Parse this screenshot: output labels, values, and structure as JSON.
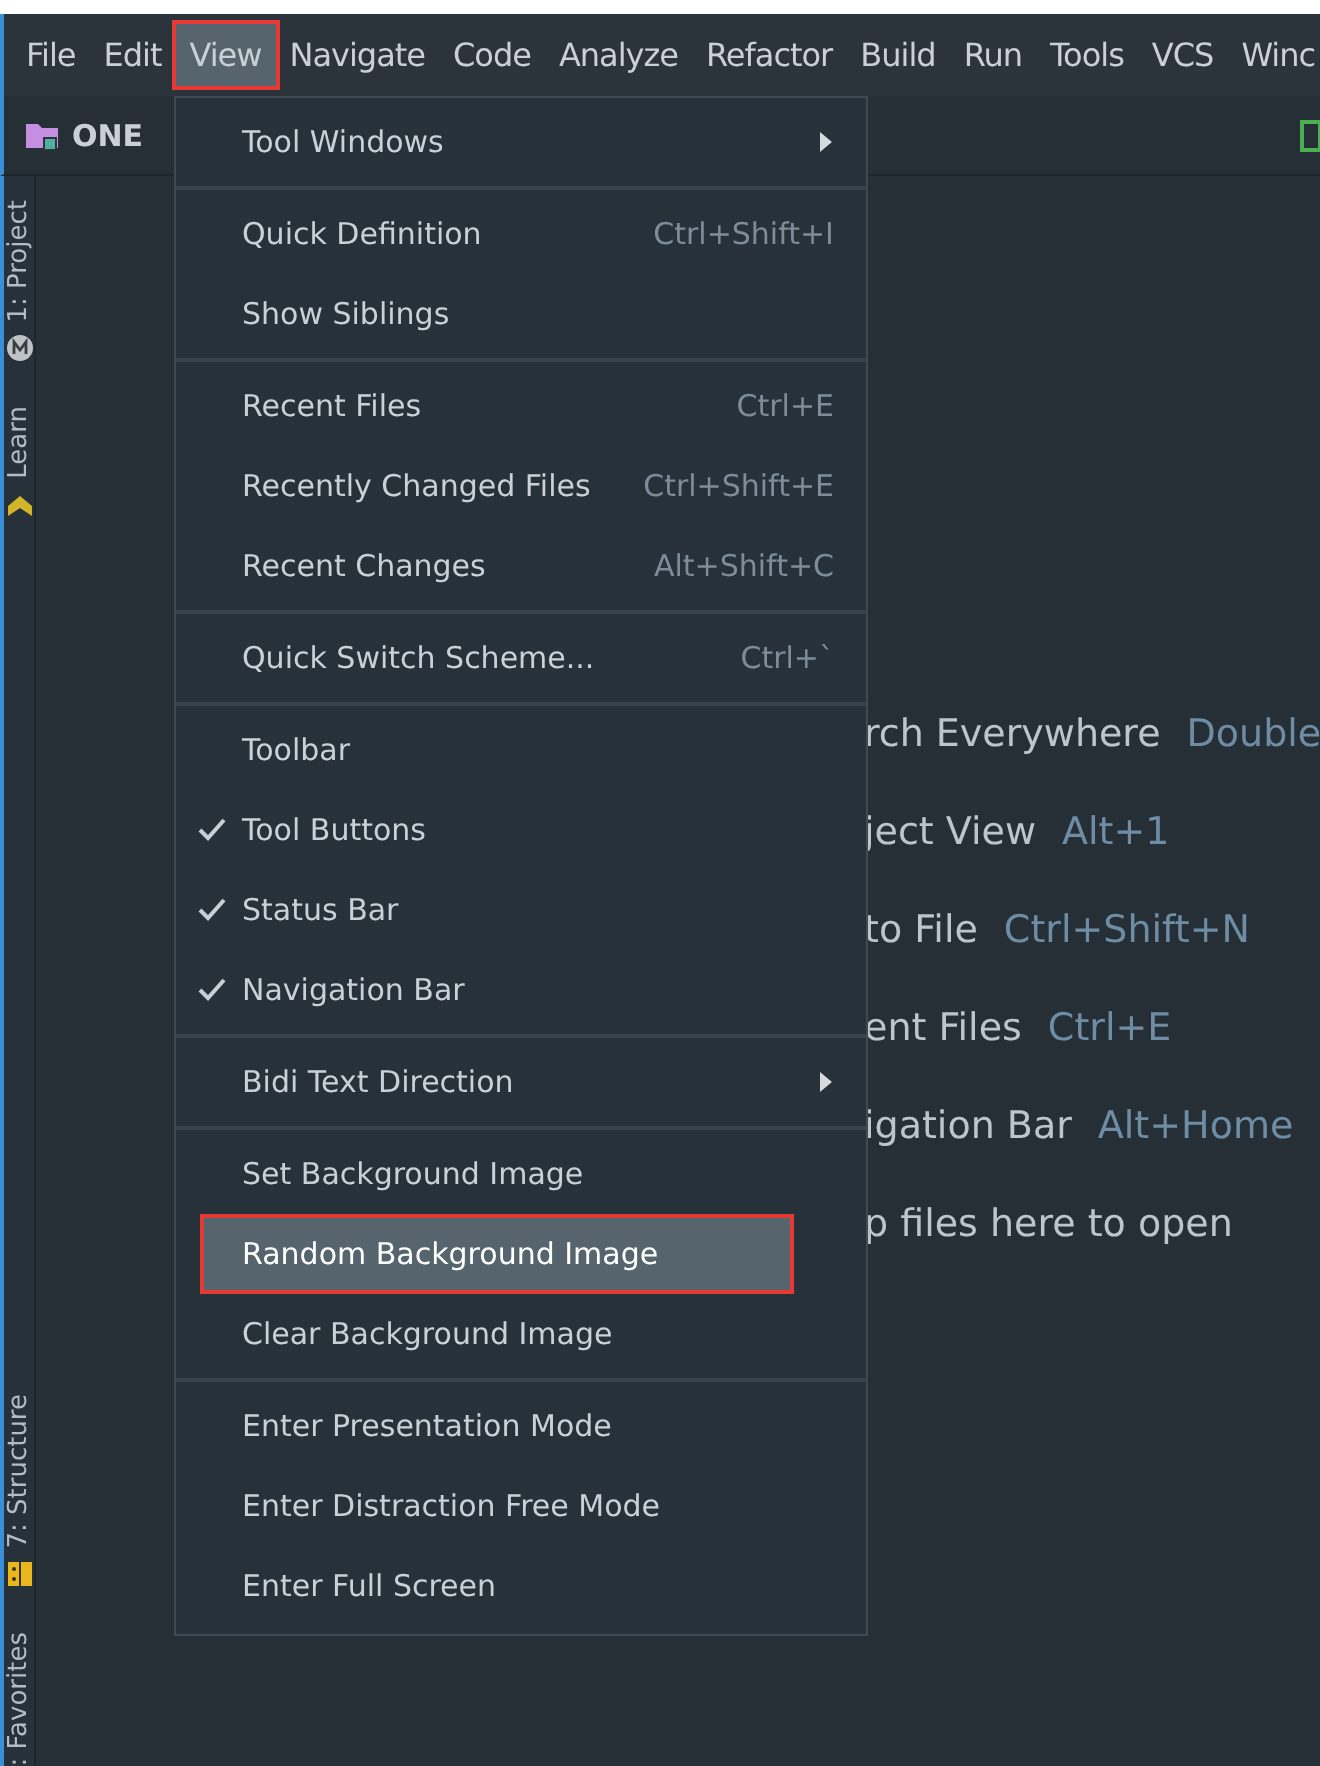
{
  "menu_bar": [
    {
      "label": "File",
      "selected": false,
      "marked": false
    },
    {
      "label": "Edit",
      "selected": false,
      "marked": false
    },
    {
      "label": "View",
      "selected": true,
      "marked": true
    },
    {
      "label": "Navigate",
      "selected": false,
      "marked": false
    },
    {
      "label": "Code",
      "selected": false,
      "marked": false
    },
    {
      "label": "Analyze",
      "selected": false,
      "marked": false
    },
    {
      "label": "Refactor",
      "selected": false,
      "marked": false
    },
    {
      "label": "Build",
      "selected": false,
      "marked": false
    },
    {
      "label": "Run",
      "selected": false,
      "marked": false
    },
    {
      "label": "Tools",
      "selected": false,
      "marked": false
    },
    {
      "label": "VCS",
      "selected": false,
      "marked": false
    },
    {
      "label": "Winc",
      "selected": false,
      "marked": false
    }
  ],
  "navigation_bar": {
    "project": "ONE"
  },
  "side_tabs_top": [
    {
      "label": "1: Project"
    },
    {
      "label": "Learn"
    }
  ],
  "side_tabs_bottom": [
    {
      "label": "7: Structure"
    },
    {
      "label": ": Favorites"
    }
  ],
  "hints": [
    {
      "action": "rch Everywhere",
      "shortcut": "Double"
    },
    {
      "action": "ject View",
      "shortcut": "Alt+1"
    },
    {
      "action": "to File",
      "shortcut": "Ctrl+Shift+N"
    },
    {
      "action": "ent Files",
      "shortcut": "Ctrl+E"
    },
    {
      "action": "igation Bar",
      "shortcut": "Alt+Home"
    },
    {
      "action": "p files here to open"
    }
  ],
  "view_menu": [
    [
      {
        "label": "Tool Windows",
        "submenu": true,
        "checked": false,
        "selected": false,
        "marked": false
      }
    ],
    [
      {
        "label": "Quick Definition",
        "shortcut": "Ctrl+Shift+I",
        "checked": false,
        "selected": false,
        "marked": false
      },
      {
        "label": "Show Siblings",
        "checked": false,
        "selected": false,
        "marked": false
      }
    ],
    [
      {
        "label": "Recent Files",
        "shortcut": "Ctrl+E",
        "checked": false,
        "selected": false,
        "marked": false
      },
      {
        "label": "Recently Changed Files",
        "shortcut": "Ctrl+Shift+E",
        "checked": false,
        "selected": false,
        "marked": false
      },
      {
        "label": "Recent Changes",
        "shortcut": "Alt+Shift+C",
        "checked": false,
        "selected": false,
        "marked": false
      }
    ],
    [
      {
        "label": "Quick Switch Scheme...",
        "shortcut": "Ctrl+`",
        "checked": false,
        "selected": false,
        "marked": false
      }
    ],
    [
      {
        "label": "Toolbar",
        "checked": false,
        "selected": false,
        "marked": false
      },
      {
        "label": "Tool Buttons",
        "checked": true,
        "selected": false,
        "marked": false
      },
      {
        "label": "Status Bar",
        "checked": true,
        "selected": false,
        "marked": false
      },
      {
        "label": "Navigation Bar",
        "checked": true,
        "selected": false,
        "marked": false
      }
    ],
    [
      {
        "label": "Bidi Text Direction",
        "submenu": true,
        "checked": false,
        "selected": false,
        "marked": false
      }
    ],
    [
      {
        "label": "Set Background Image",
        "checked": false,
        "selected": false,
        "marked": false
      },
      {
        "label": "Random Background Image",
        "checked": false,
        "selected": true,
        "marked": true
      },
      {
        "label": "Clear Background Image",
        "checked": false,
        "selected": false,
        "marked": false
      }
    ],
    [
      {
        "label": "Enter Presentation Mode",
        "checked": false,
        "selected": false,
        "marked": false
      },
      {
        "label": "Enter Distraction Free Mode",
        "checked": false,
        "selected": false,
        "marked": false
      },
      {
        "label": "Enter Full Screen",
        "checked": false,
        "selected": false,
        "marked": false
      }
    ]
  ]
}
